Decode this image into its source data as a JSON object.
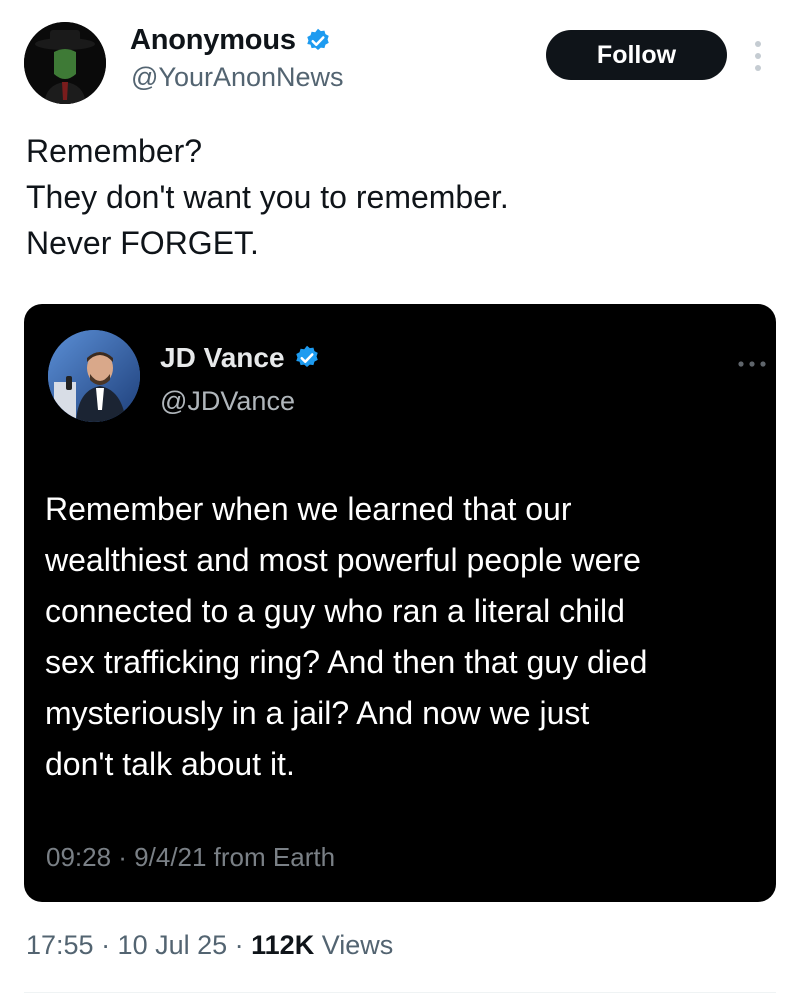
{
  "author": {
    "display_name": "Anonymous",
    "handle": "@YourAnonNews",
    "verified": true,
    "follow_label": "Follow"
  },
  "tweet": {
    "lines": [
      "Remember?",
      "They don't want you to remember.",
      "Never FORGET."
    ]
  },
  "quoted": {
    "display_name": "JD Vance",
    "handle": "@JDVance",
    "verified": true,
    "lines": [
      "Remember when we learned that our",
      "wealthiest and most powerful people were",
      "connected to a guy who ran a literal child",
      "sex trafficking ring? And then that guy died",
      "mysteriously in a jail? And now we just",
      "don't talk about it."
    ],
    "meta": "09:28 · 9/4/21 from Earth"
  },
  "meta": {
    "time_date": "17:55 · 10 Jul 25 · ",
    "views_count": "112K",
    "views_label": " Views"
  },
  "colors": {
    "verified_blue": "#1d9bf0",
    "text_primary": "#0f1419",
    "text_secondary": "#536471",
    "follow_bg": "#0f1419",
    "card_bg": "#000000"
  },
  "icons": {
    "verified": "verified-badge-icon",
    "more": "more-options-icon"
  }
}
